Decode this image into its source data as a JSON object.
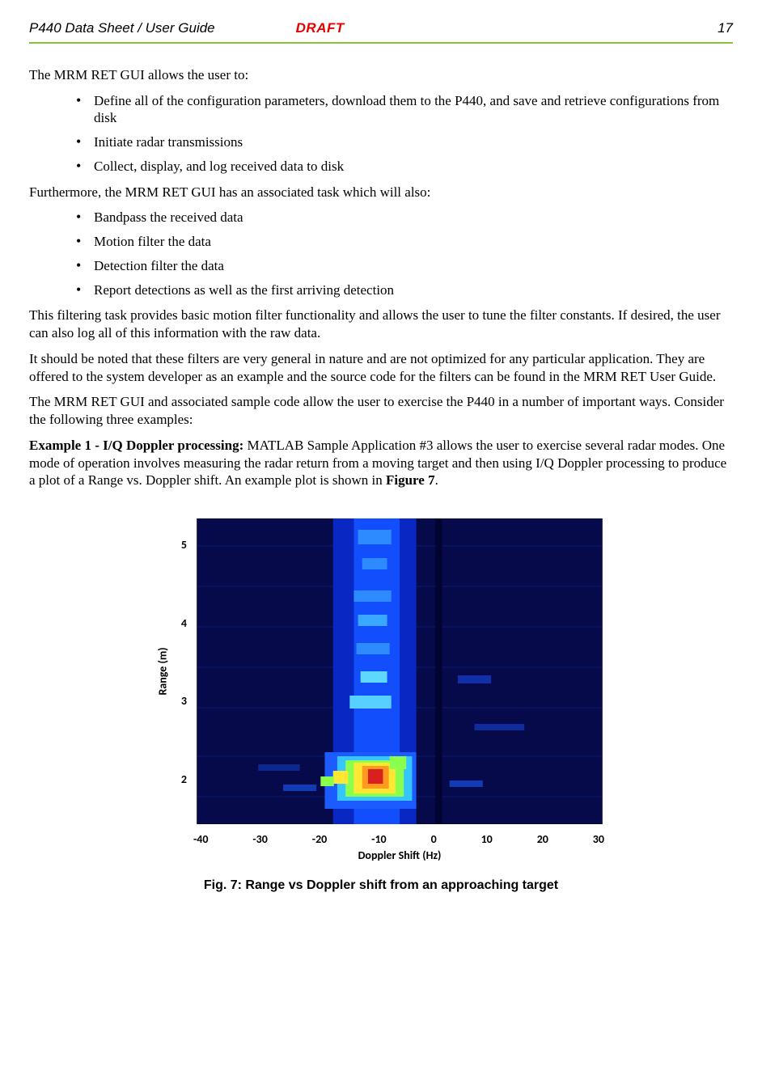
{
  "header": {
    "title": "P440 Data Sheet / User Guide",
    "draft": "DRAFT",
    "page": "17"
  },
  "para1": "The MRM RET GUI allows the user to:",
  "list1": {
    "i0": "Define all of the configuration parameters, download them to the P440, and save and retrieve configurations from disk",
    "i1": "Initiate radar transmissions",
    "i2": "Collect, display, and log received data to disk"
  },
  "para2": "Furthermore, the MRM RET GUI has an associated task which will also:",
  "list2": {
    "i0": "Bandpass the received data",
    "i1": "Motion filter the data",
    "i2": "Detection filter the data",
    "i3": "Report detections as well as the first arriving detection"
  },
  "para3": "This filtering task provides basic motion filter functionality and allows the user to tune the filter constants.  If desired, the user can also log all of this information with the raw data.",
  "para4": "It should be noted that these filters are very general in nature and are not optimized for any particular application.   They are offered to the system developer as an example and the source code for the filters can be found in the MRM RET User Guide.",
  "para5": "The MRM RET GUI and associated sample code allow the user to exercise the P440 in a number of important ways.   Consider the following three examples:",
  "ex1": {
    "lead": "Example 1 - I/Q Doppler processing:",
    "rest": "  MATLAB Sample Application #3 allows the user to exercise several radar modes. One mode of operation involves measuring the radar return from a moving target and then using I/Q Doppler processing to produce a plot of a Range vs. Doppler shift.   An example plot is shown in ",
    "figref": "Figure 7",
    "tail": "."
  },
  "figure": {
    "caption": "Fig. 7:  Range vs Doppler shift from an approaching target",
    "ylabel": "Range (m)",
    "xlabel": "Doppler Shift (Hz)",
    "yticks": {
      "t0": "5",
      "t1": "4",
      "t2": "3",
      "t3": "2"
    },
    "xticks": {
      "t0": "-40",
      "t1": "-30",
      "t2": "-20",
      "t3": "-10",
      "t4": "0",
      "t5": "10",
      "t6": "20",
      "t7": "30"
    }
  },
  "chart_data": {
    "type": "heatmap",
    "title": "Range vs Doppler shift from an approaching target",
    "xlabel": "Doppler Shift (Hz)",
    "ylabel": "Range (m)",
    "x_range": [
      -40,
      35
    ],
    "y_range": [
      1.3,
      5.5
    ],
    "x_ticks": [
      -40,
      -30,
      -20,
      -10,
      0,
      10,
      20,
      30
    ],
    "y_ticks": [
      2,
      3,
      4,
      5
    ],
    "colormap": "jet",
    "description": "Background is low-intensity dark blue. A bright vertical column of elevated intensity runs near Doppler ≈ -10 to 0 Hz across all ranges. The strongest returns (yellow/red hot spots) are concentrated around Doppler ≈ -15 to -5 Hz and Range ≈ 1.6–2.2 m. A narrow dark vertical notch appears near Doppler ≈ +3 Hz.",
    "hotspots": [
      {
        "doppler_hz": -12,
        "range_m": 1.8,
        "intensity": "max"
      },
      {
        "doppler_hz": -8,
        "range_m": 1.9,
        "intensity": "high"
      },
      {
        "doppler_hz": -15,
        "range_m": 2.0,
        "intensity": "high"
      },
      {
        "doppler_hz": -10,
        "range_m": 2.3,
        "intensity": "medium"
      },
      {
        "doppler_hz": -8,
        "range_m": 3.0,
        "intensity": "medium"
      },
      {
        "doppler_hz": -8,
        "range_m": 4.0,
        "intensity": "low-medium"
      },
      {
        "doppler_hz": -8,
        "range_m": 5.0,
        "intensity": "low-medium"
      }
    ]
  }
}
